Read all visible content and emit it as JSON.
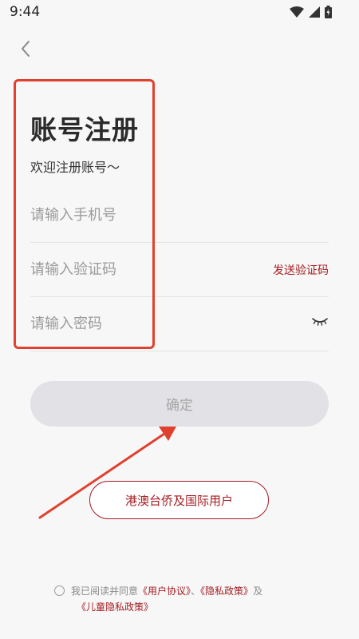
{
  "status_bar": {
    "time": "9:44"
  },
  "page": {
    "title": "账号注册",
    "subtitle": "欢迎注册账号～"
  },
  "form": {
    "phone_placeholder": "请输入手机号",
    "code_placeholder": "请输入验证码",
    "send_code_label": "发送验证码",
    "password_placeholder": "请输入密码",
    "confirm_label": "确定"
  },
  "intl_button_label": "港澳台侨及国际用户",
  "agreement": {
    "prefix": "我已阅读并同意",
    "user_agreement": "《用户协议》",
    "separator": "、",
    "privacy_policy": "《隐私政策》",
    "conjunction": "及",
    "child_privacy_policy": "《儿童隐私政策》"
  },
  "colors": {
    "accent": "#a51c22",
    "highlight": "#e0412f",
    "button_disabled_bg": "#e1e1e6"
  }
}
